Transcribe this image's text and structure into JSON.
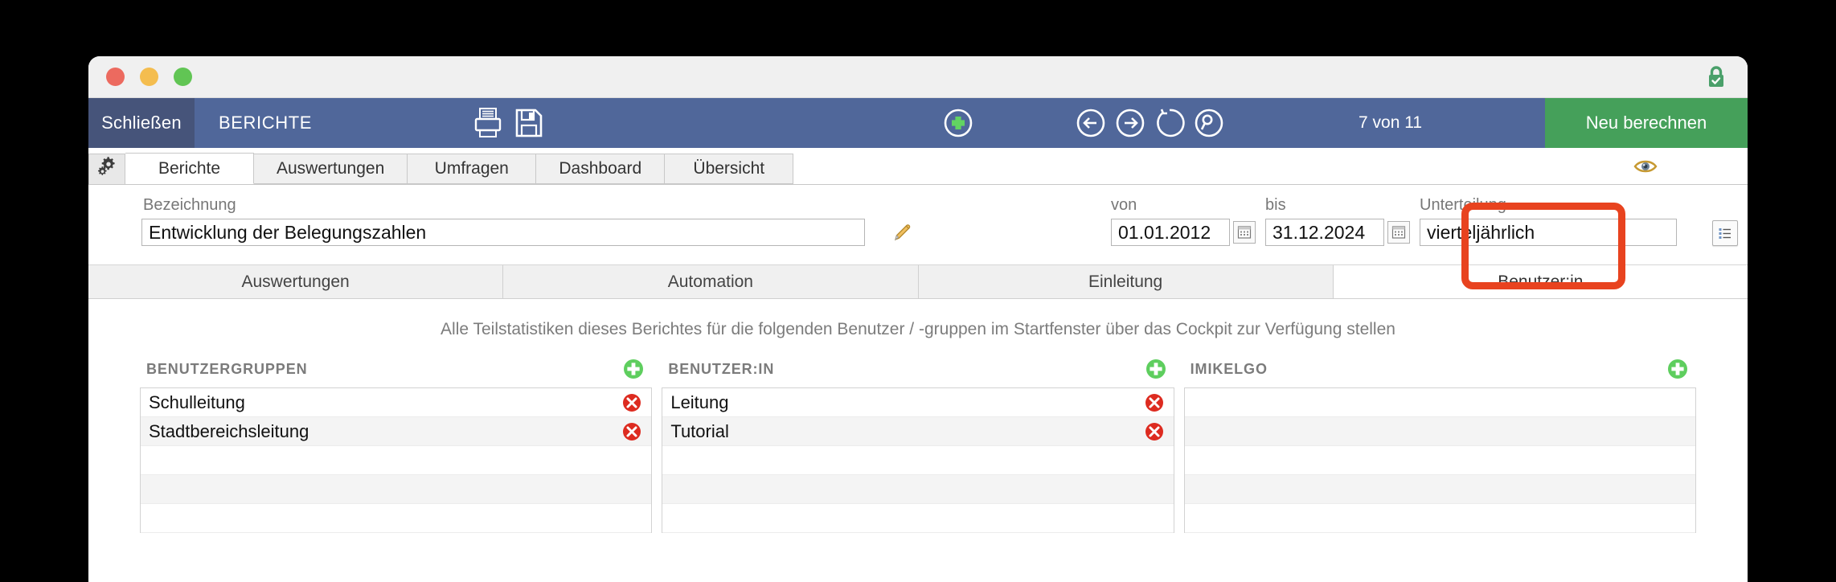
{
  "window": {
    "lock_icon": "lock-secure-icon",
    "traffic_lights": [
      "close",
      "minimize",
      "maximize"
    ]
  },
  "toolbar": {
    "close_label": "Schließen",
    "section_label": "BERICHTE",
    "print_icon": "printer-icon",
    "save_icon": "floppy-save-icon",
    "add_icon": "plus-circle-icon",
    "prev_icon": "arrow-left-circle-icon",
    "next_icon": "arrow-right-circle-icon",
    "refresh_icon": "refresh-circle-icon",
    "search_icon": "search-circle-icon",
    "record_counter": "7 von 11",
    "recalc_label": "Neu berechnen",
    "bg_color": "#50679a",
    "close_bg_color": "#46547a",
    "recalc_color": "#45a05a"
  },
  "tabstrip": {
    "gear_icon": "gear-icon",
    "eye_icon": "eye-icon",
    "tabs": [
      {
        "label": "Berichte",
        "active": true
      },
      {
        "label": "Auswertungen",
        "active": false
      },
      {
        "label": "Umfragen",
        "active": false
      },
      {
        "label": "Dashboard",
        "active": false
      },
      {
        "label": "Übersicht",
        "active": false
      }
    ]
  },
  "form": {
    "bezeichnung_label": "Bezeichnung",
    "bezeichnung_value": "Entwicklung der Belegungszahlen",
    "pencil_icon": "pencil-edit-icon",
    "von_label": "von",
    "von_value": "01.01.2012",
    "bis_label": "bis",
    "bis_value": "31.12.2024",
    "unterteilung_label": "Unterteilung",
    "unterteilung_value": "vierteljährlich",
    "calendar_icon": "calendar-picker-icon",
    "list_icon": "list-options-icon"
  },
  "inner_tabs": [
    {
      "label": "Auswertungen",
      "active": false
    },
    {
      "label": "Automation",
      "active": false
    },
    {
      "label": "Einleitung",
      "active": false
    },
    {
      "label": "Benutzer:in",
      "active": true
    }
  ],
  "description": "Alle Teilstatistiken dieses Berichtes für die folgenden Benutzer / -gruppen im Startfenster über das Cockpit zur Verfügung stellen",
  "columns": [
    {
      "title": "BENUTZERGRUPPEN",
      "add_icon": "plus-circle-green-icon",
      "items": [
        "Schulleitung",
        "Stadtbereichsleitung"
      ],
      "empty_rows": 3,
      "delete_icon": "delete-circle-red-icon"
    },
    {
      "title": "BENUTZER:IN",
      "add_icon": "plus-circle-green-icon",
      "items": [
        "Leitung",
        "Tutorial"
      ],
      "empty_rows": 3,
      "delete_icon": "delete-circle-red-icon"
    },
    {
      "title": "IMIKELGO",
      "add_icon": "plus-circle-green-icon",
      "items": [],
      "empty_rows": 5,
      "delete_icon": "delete-circle-red-icon"
    }
  ],
  "annotation": {
    "target": "Benutzer:in",
    "color": "#e8431f"
  }
}
